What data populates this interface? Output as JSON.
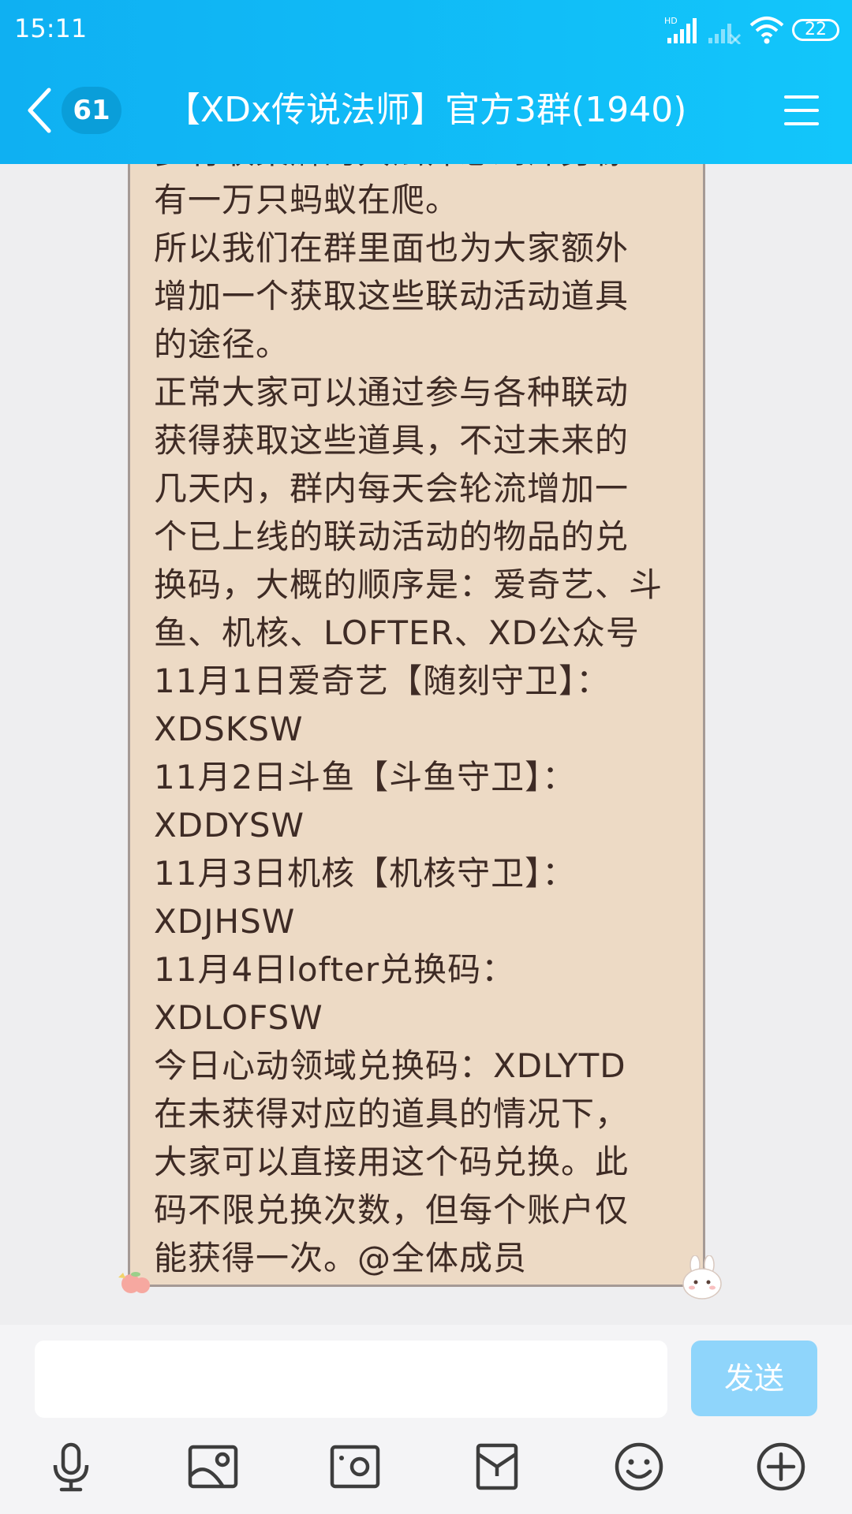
{
  "status_bar": {
    "time": "15:11",
    "hd_label": "HD",
    "battery": "22"
  },
  "header": {
    "unread_count": "61",
    "title": "【XDx传说法师】官方3群(1940)"
  },
  "message": {
    "lines": [
      "多有收集癖的大法师想到浑身像",
      "有一万只蚂蚁在爬。",
      "所以我们在群里面也为大家额外",
      "增加一个获取这些联动活动道具",
      "的途径。",
      "正常大家可以通过参与各种联动",
      "获得获取这些道具，不过未来的",
      "几天内，群内每天会轮流增加一",
      "个已上线的联动活动的物品的兑",
      "换码，大概的顺序是：爱奇艺、斗",
      "鱼、机核、LOFTER、XD公众号",
      "11月1日爱奇艺【随刻守卫】：",
      "XDSKSW",
      "11月2日斗鱼【斗鱼守卫】：",
      "XDDYSW",
      "11月3日机核【机核守卫】：",
      "XDJHSW",
      "11月4日lofter兑换码：",
      "XDLOFSW",
      "今日心动领域兑换码：XDLYTD",
      "在未获得对应的道具的情况下，",
      "大家可以直接用这个码兑换。此",
      "码不限兑换次数，但每个账户仅",
      "能获得一次。@全体成员"
    ]
  },
  "input": {
    "value": "",
    "send_label": "发送"
  },
  "toolbar": {
    "items": [
      "microphone-icon",
      "image-icon",
      "camera-icon",
      "red-packet-icon",
      "emoji-icon",
      "plus-icon"
    ]
  },
  "colors": {
    "header_bg": "#12c6fb",
    "bubble_bg": "#eddac5",
    "bubble_text": "#3e2b25",
    "send_button_bg": "#8fd5fb"
  }
}
